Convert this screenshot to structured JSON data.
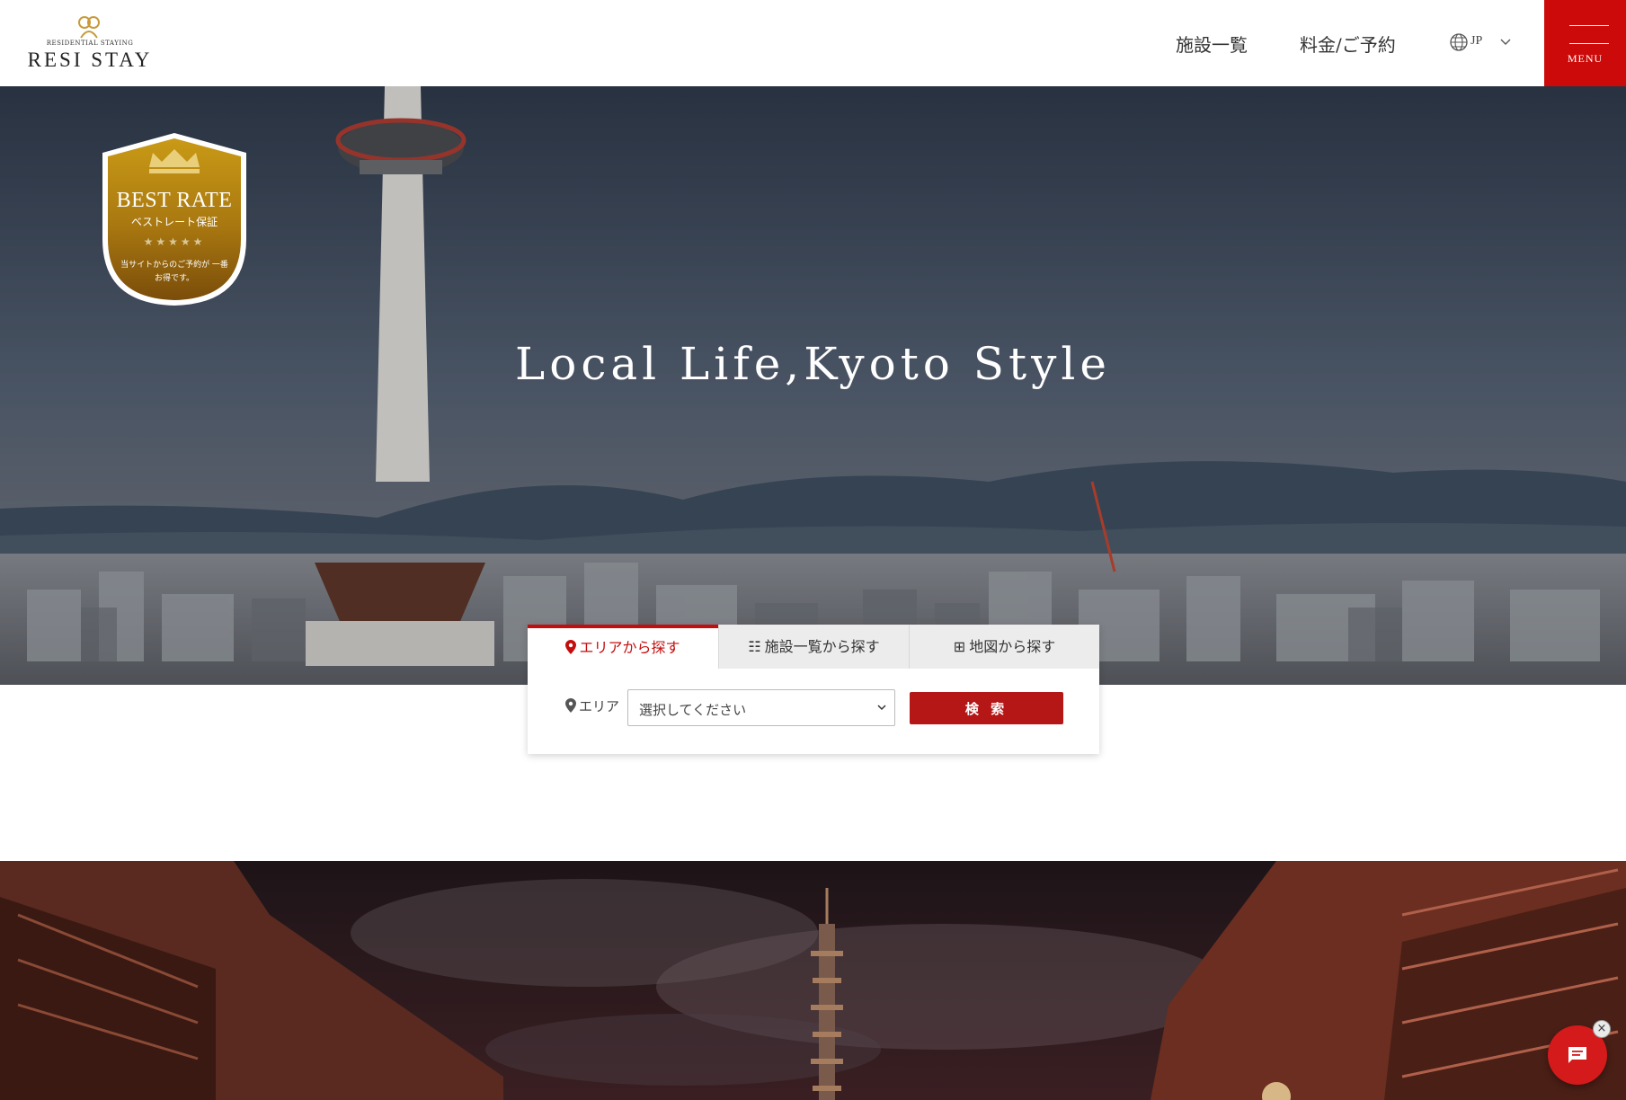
{
  "header": {
    "logo_sub": "RESIDENTIAL STAYING",
    "logo_main": "RESI STAY",
    "nav": [
      "施設一覧",
      "料金/ご予約"
    ],
    "language": "JP",
    "menu_label": "MENU"
  },
  "badge": {
    "title": "BEST RATE",
    "subtitle": "ベストレート保証",
    "stars": "★★★★★",
    "note": "当サイトからのご予約が 一番お得です。"
  },
  "hero": {
    "title": "Local Life,Kyoto Style"
  },
  "search": {
    "tabs": [
      "エリアから探す",
      "施設一覧から探す",
      "地図から探す"
    ],
    "active_tab": 0,
    "area_label": "エリア",
    "select_placeholder": "選択してください",
    "button_label": "検 索"
  },
  "chat": {
    "close_symbol": "×"
  },
  "colors": {
    "brand_red": "#cc0a0a",
    "button_red": "#b51616",
    "badge_gold": "#b8870f"
  }
}
